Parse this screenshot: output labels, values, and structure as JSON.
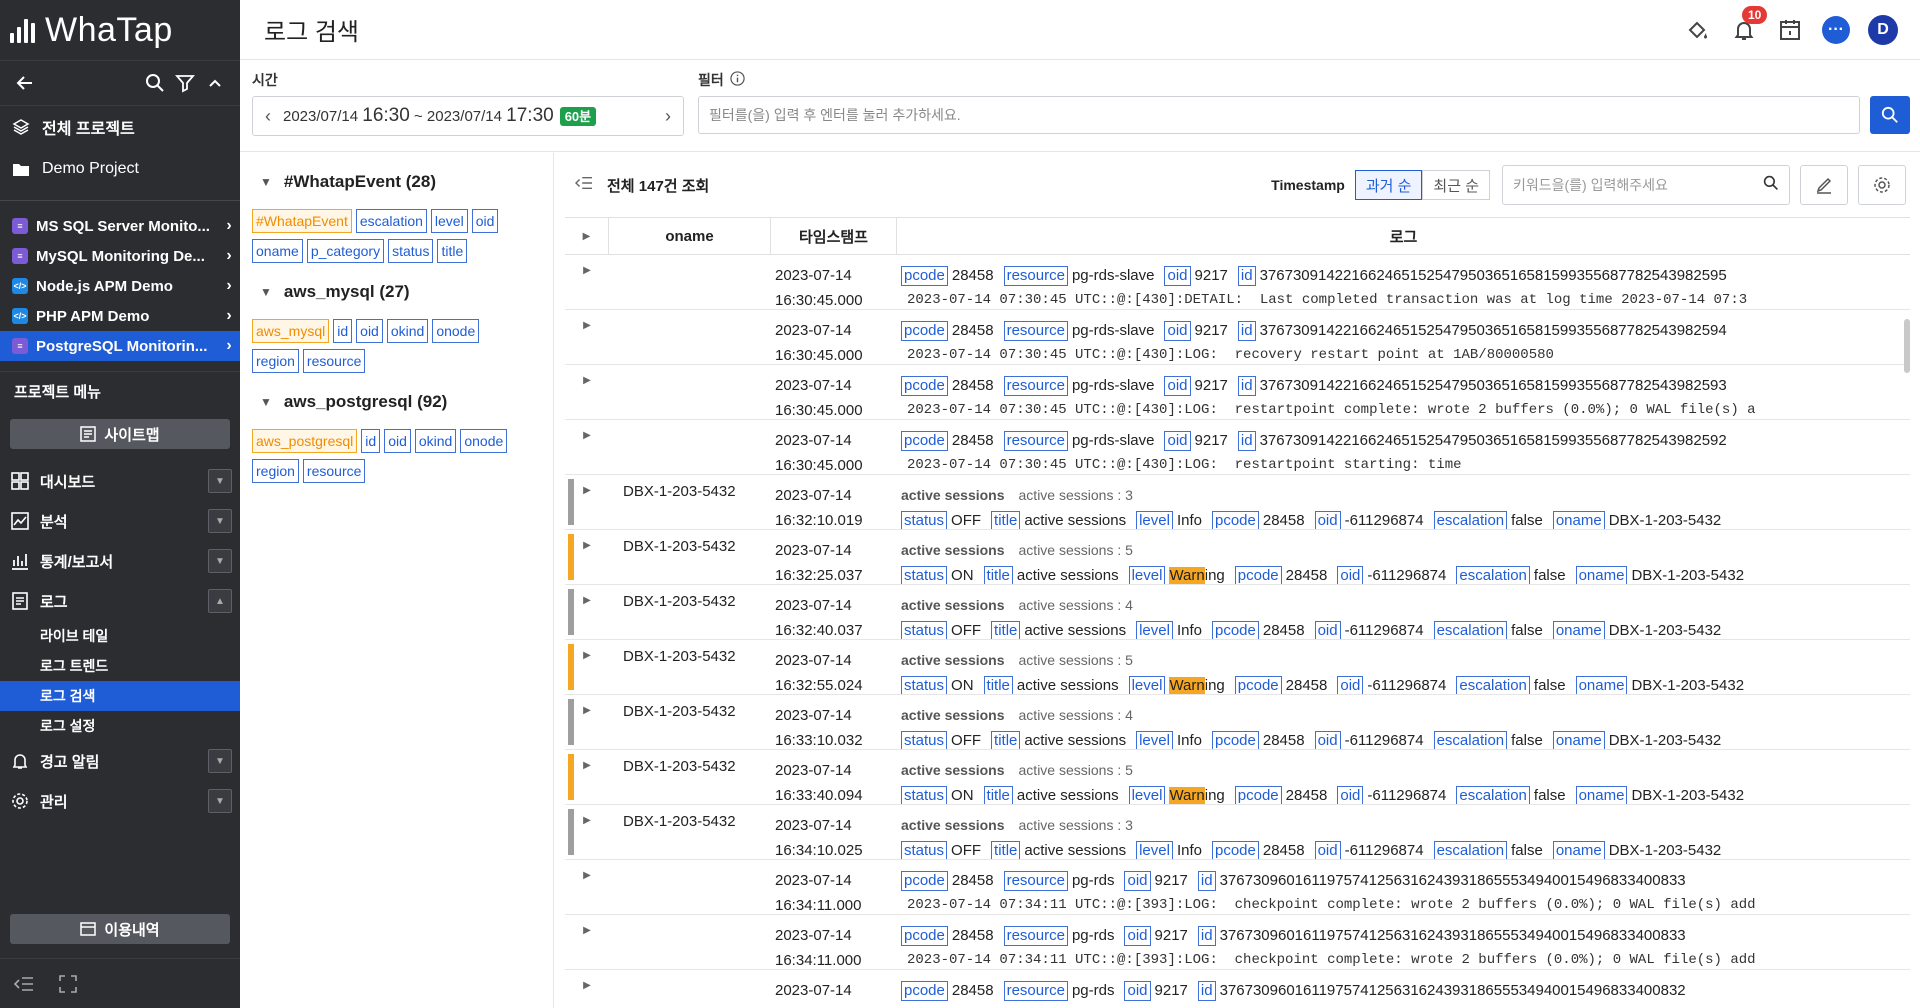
{
  "app": {
    "logo_text": "WhaTap"
  },
  "sidebar": {
    "all_projects": "전체 프로젝트",
    "demo_project": "Demo Project",
    "projects": [
      {
        "label": "MS SQL Server Monito...",
        "color": "#7b5cd6",
        "icon": "database-icon"
      },
      {
        "label": "MySQL Monitoring De...",
        "color": "#7b5cd6",
        "icon": "database-icon"
      },
      {
        "label": "Node.js APM Demo",
        "color": "#1e88e5",
        "icon": "code-icon"
      },
      {
        "label": "PHP APM Demo",
        "color": "#1e88e5",
        "icon": "code-icon"
      },
      {
        "label": "PostgreSQL Monitorin...",
        "color": "#7b5cd6",
        "icon": "database-icon"
      }
    ],
    "menu_title": "프로젝트 메뉴",
    "sitemap": "사이트맵",
    "nav": [
      {
        "label": "대시보드",
        "icon": "dashboard-icon"
      },
      {
        "label": "분석",
        "icon": "analysis-icon"
      },
      {
        "label": "통계/보고서",
        "icon": "stats-icon"
      },
      {
        "label": "로그",
        "icon": "log-icon"
      }
    ],
    "log_sub": [
      "라이브 테일",
      "로그 트렌드",
      "로그 검색",
      "로그 설정"
    ],
    "nav_after": [
      {
        "label": "경고 알림",
        "icon": "bell-icon"
      },
      {
        "label": "관리",
        "icon": "gear-icon"
      }
    ],
    "usage": "이용내역"
  },
  "header": {
    "title": "로그 검색",
    "notif_count": "10",
    "avatar": "D"
  },
  "filter_bar": {
    "time_label": "시간",
    "time_from_date": "2023/07/14 ",
    "time_from_hm": "16:30",
    "time_sep": " ~ ",
    "time_to_date": "2023/07/14 ",
    "time_to_hm": "17:30",
    "duration": "60분",
    "filter_label": "필터",
    "filter_placeholder": "필터를(을) 입력 후 엔터를 눌러 추가하세요."
  },
  "facets": [
    {
      "title": "#WhatapEvent (28)",
      "tags": [
        "#WhatapEvent",
        "escalation",
        "level",
        "oid",
        "oname",
        "p_category",
        "status",
        "title"
      ]
    },
    {
      "title": "aws_mysql (27)",
      "tags": [
        "aws_mysql",
        "id",
        "oid",
        "okind",
        "onode",
        "region",
        "resource"
      ]
    },
    {
      "title": "aws_postgresql (92)",
      "tags": [
        "aws_postgresql",
        "id",
        "oid",
        "okind",
        "onode",
        "region",
        "resource"
      ]
    }
  ],
  "log_toolbar": {
    "count": "전체 147건 조회",
    "ts_label": "Timestamp",
    "sort_old": "과거 순",
    "sort_new": "최근 순",
    "keyword_placeholder": "키워드을(를) 입력해주세요"
  },
  "columns": {
    "oname": "oname",
    "ts": "타임스탬프",
    "log": "로그"
  },
  "rows": [
    {
      "kind": "rds",
      "oname": "",
      "date": "2023-07-14",
      "time": "16:30:45.000",
      "res": "pg-rds-slave",
      "id": "376730914221662465152547950365165815993556877825439825​95",
      "msg": "2023-07-14 07:30:45 UTC::@:[430]:DETAIL:  Last completed transaction was at log time 2023-07-14 07:3"
    },
    {
      "kind": "rds",
      "oname": "",
      "date": "2023-07-14",
      "time": "16:30:45.000",
      "res": "pg-rds-slave",
      "id": "37673091422166246515254795036516581599355687782543982594",
      "msg": "2023-07-14 07:30:45 UTC::@:[430]:LOG:  recovery restart point at 1AB/80000580"
    },
    {
      "kind": "rds",
      "oname": "",
      "date": "2023-07-14",
      "time": "16:30:45.000",
      "res": "pg-rds-slave",
      "id": "37673091422166246515254795036516581599355687782543982593",
      "msg": "2023-07-14 07:30:45 UTC::@:[430]:LOG:  restartpoint complete: wrote 2 buffers (0.0%); 0 WAL file(s) a"
    },
    {
      "kind": "rds",
      "oname": "",
      "date": "2023-07-14",
      "time": "16:30:45.000",
      "res": "pg-rds-slave",
      "id": "37673091422166246515254795036516581599355687782543982592",
      "msg": "2023-07-14 07:30:45 UTC::@:[430]:LOG:  restartpoint starting: time"
    },
    {
      "kind": "event",
      "oname": "DBX-1-203-5432",
      "date": "2023-07-14",
      "time": "16:32:10.019",
      "sess": "active sessions : 3",
      "status": "OFF",
      "level": "Info",
      "color": "#9e9e9e"
    },
    {
      "kind": "event",
      "oname": "DBX-1-203-5432",
      "date": "2023-07-14",
      "time": "16:32:25.037",
      "sess": "active sessions : 5",
      "status": "ON",
      "level": "Warning",
      "color": "#f5a623"
    },
    {
      "kind": "event",
      "oname": "DBX-1-203-5432",
      "date": "2023-07-14",
      "time": "16:32:40.037",
      "sess": "active sessions : 4",
      "status": "OFF",
      "level": "Info",
      "color": "#9e9e9e"
    },
    {
      "kind": "event",
      "oname": "DBX-1-203-5432",
      "date": "2023-07-14",
      "time": "16:32:55.024",
      "sess": "active sessions : 5",
      "status": "ON",
      "level": "Warning",
      "color": "#f5a623"
    },
    {
      "kind": "event",
      "oname": "DBX-1-203-5432",
      "date": "2023-07-14",
      "time": "16:33:10.032",
      "sess": "active sessions : 4",
      "status": "OFF",
      "level": "Info",
      "color": "#9e9e9e"
    },
    {
      "kind": "event",
      "oname": "DBX-1-203-5432",
      "date": "2023-07-14",
      "time": "16:33:40.094",
      "sess": "active sessions : 5",
      "status": "ON",
      "level": "Warning",
      "color": "#f5a623"
    },
    {
      "kind": "event",
      "oname": "DBX-1-203-5432",
      "date": "2023-07-14",
      "time": "16:34:10.025",
      "sess": "active sessions : 3",
      "status": "OFF",
      "level": "Info",
      "color": "#9e9e9e"
    },
    {
      "kind": "rds2",
      "oname": "",
      "date": "2023-07-14",
      "time": "16:34:11.000",
      "res": "pg-rds",
      "id": "37673096016119757412563162439318655534940015496833400833",
      "msg": "2023-07-14 07:34:11 UTC::@:[393]:LOG:  checkpoint complete: wrote 2 buffers (0.0%); 0 WAL file(s) add"
    },
    {
      "kind": "rds2",
      "oname": "",
      "date": "2023-07-14",
      "time": "16:34:11.000",
      "res": "pg-rds",
      "id": "37673096016119757412563162439318655534940015496833400833",
      "msg": "2023-07-14 07:34:11 UTC::@:[393]:LOG:  checkpoint complete: wrote 2 buffers (0.0%); 0 WAL file(s) add"
    },
    {
      "kind": "rds2",
      "oname": "",
      "date": "2023-07-14",
      "time": "",
      "res": "pg-rds",
      "id": "37673096016119757412563162439318655534940015496833400832",
      "msg": ""
    }
  ],
  "field_keys": {
    "pcode": "pcode",
    "resource": "resource",
    "oid": "oid",
    "id": "id",
    "status": "status",
    "title": "title",
    "level": "level",
    "escalation": "escalation",
    "oname": "oname",
    "sess_key": "active sessions"
  },
  "field_vals": {
    "pcode": "28458",
    "oid_rds": "9217",
    "oid_event": "-611296874",
    "title": "active sessions",
    "escalation": "false",
    "oname": "DBX-1-203-5432"
  }
}
